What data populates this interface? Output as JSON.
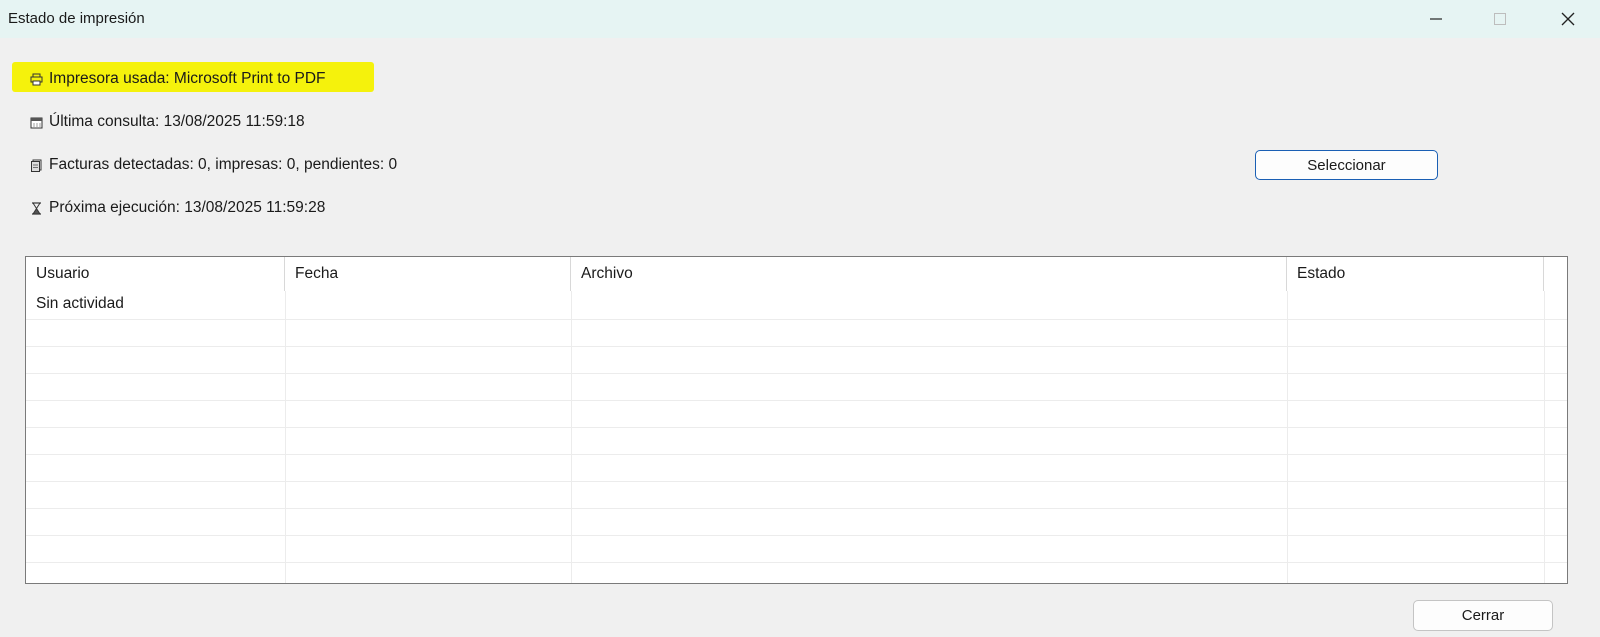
{
  "window": {
    "title": "Estado de impresión",
    "controls": [
      "minimize-icon",
      "maximize-icon",
      "close-icon"
    ]
  },
  "info": {
    "printer": "Impresora usada: Microsoft Print to PDF",
    "last_query": "Última consulta: 13/08/2025 11:59:18",
    "invoices": "Facturas detectadas: 0, impresas: 0, pendientes: 0",
    "next_run": "Próxima ejecución: 13/08/2025 11:59:28",
    "icons": [
      "printer-icon",
      "calendar-icon",
      "document-icon",
      "hourglass-icon"
    ],
    "highlight_color": "#f5f20c"
  },
  "buttons": {
    "select_label": "Seleccionar",
    "close_label": "Cerrar"
  },
  "table": {
    "columns": [
      "Usuario",
      "Fecha",
      "Archivo",
      "Estado"
    ],
    "rows": [
      [
        "Sin actividad",
        "",
        "",
        ""
      ]
    ]
  },
  "colors": {
    "titlebar_bg": "#e6f4f3",
    "window_bg": "#f0f0f0",
    "accent_border": "#1a5fb4"
  }
}
